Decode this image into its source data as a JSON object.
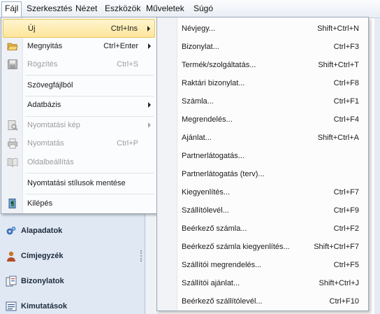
{
  "menubar": {
    "items": [
      {
        "label": "Fájl"
      },
      {
        "label": "Szerkesztés"
      },
      {
        "label": "Nézet"
      },
      {
        "label": "Eszközök"
      },
      {
        "label": "Műveletek"
      },
      {
        "label": "Súgó"
      }
    ]
  },
  "navigation": {
    "items": [
      {
        "label": "Alapadatok",
        "icon": "gears-icon"
      },
      {
        "label": "Címjegyzék",
        "icon": "contact-person-icon"
      },
      {
        "label": "Bizonylatok",
        "icon": "documents-icon"
      },
      {
        "label": "Kimutatások",
        "icon": "report-list-icon"
      }
    ]
  },
  "file_menu": {
    "items": [
      {
        "label": "Új",
        "shortcut": "Ctrl+Ins",
        "submenu": true,
        "enabled": true,
        "highlighted": true,
        "icon": ""
      },
      {
        "label": "Megnyitás",
        "shortcut": "Ctrl+Enter",
        "submenu": true,
        "enabled": true,
        "icon": "open-folder-icon"
      },
      {
        "label": "Rögzítés",
        "shortcut": "Ctrl+S",
        "submenu": false,
        "enabled": false,
        "icon": "save-disk-icon"
      },
      {
        "label": "Szövegfájlból",
        "shortcut": "",
        "submenu": false,
        "enabled": true,
        "icon": ""
      },
      {
        "label": "Adatbázis",
        "shortcut": "",
        "submenu": true,
        "enabled": true,
        "icon": ""
      },
      {
        "label": "Nyomtatási kép",
        "shortcut": "",
        "submenu": true,
        "enabled": false,
        "icon": "print-preview-icon"
      },
      {
        "label": "Nyomtatás",
        "shortcut": "Ctrl+P",
        "submenu": false,
        "enabled": false,
        "icon": "printer-icon"
      },
      {
        "label": "Oldalbeállítás",
        "shortcut": "",
        "submenu": false,
        "enabled": false,
        "icon": "page-setup-book-icon"
      },
      {
        "label": "Nyomtatási stílusok mentése",
        "shortcut": "",
        "submenu": false,
        "enabled": true,
        "icon": ""
      },
      {
        "label": "Kilépés",
        "shortcut": "",
        "submenu": false,
        "enabled": true,
        "icon": "exit-door-icon"
      }
    ]
  },
  "new_submenu": {
    "items": [
      {
        "label": "Névjegy...",
        "shortcut": "Shift+Ctrl+N"
      },
      {
        "label": "Bizonylat...",
        "shortcut": "Ctrl+F3"
      },
      {
        "label": "Termék/szolgáltatás...",
        "shortcut": "Shift+Ctrl+T"
      },
      {
        "label": "Raktári bizonylat...",
        "shortcut": "Ctrl+F8"
      },
      {
        "label": "Számla...",
        "shortcut": "Ctrl+F1"
      },
      {
        "label": "Megrendelés...",
        "shortcut": "Ctrl+F4"
      },
      {
        "label": "Ajánlat...",
        "shortcut": "Shift+Ctrl+A"
      },
      {
        "label": "Partnerlátogatás...",
        "shortcut": ""
      },
      {
        "label": "Partnerlátogatás (terv)...",
        "shortcut": ""
      },
      {
        "label": "Kiegyenlítés...",
        "shortcut": "Ctrl+F7"
      },
      {
        "label": "Szállítólevél...",
        "shortcut": "Ctrl+F9"
      },
      {
        "label": "Beérkező számla...",
        "shortcut": "Ctrl+F2"
      },
      {
        "label": "Beérkező számla kiegyenlítés...",
        "shortcut": "Shift+Ctrl+F7"
      },
      {
        "label": "Szállítói megrendelés...",
        "shortcut": "Ctrl+F5"
      },
      {
        "label": "Szállítói ajánlat...",
        "shortcut": "Shift+Ctrl+J"
      },
      {
        "label": "Beérkező szállítólevél...",
        "shortcut": "Ctrl+F10"
      }
    ]
  }
}
